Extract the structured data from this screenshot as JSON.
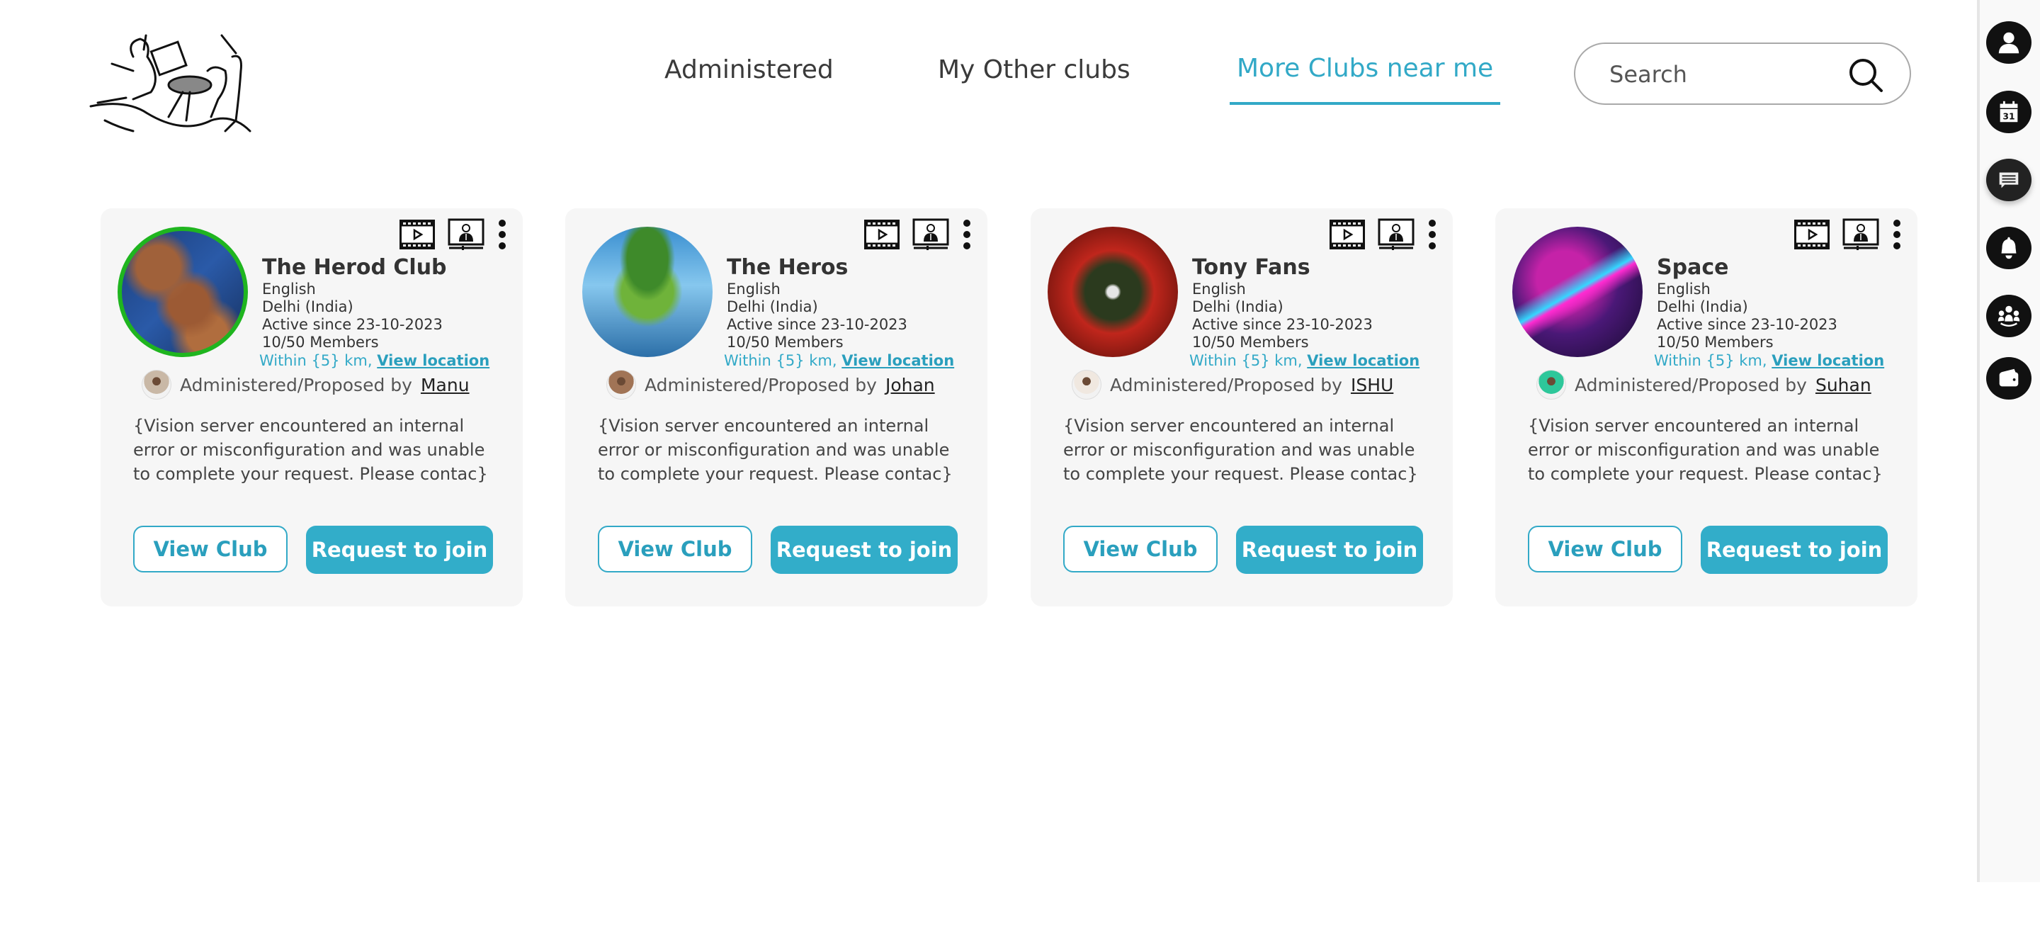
{
  "nav": {
    "tabs": [
      {
        "label": "Administered",
        "active": false
      },
      {
        "label": "My Other clubs",
        "active": false
      },
      {
        "label": "More Clubs near me",
        "active": true
      }
    ]
  },
  "search": {
    "placeholder": "Search",
    "value": ""
  },
  "colors": {
    "accent": "#32a9c7",
    "button_fill": "#32adc9",
    "active_ring": "#1fb51f",
    "rail_bg": "#f9f9f9",
    "card_bg": "#f6f6f6"
  },
  "rail": {
    "icons": [
      "profile-icon",
      "calendar-icon",
      "chat-icon",
      "bell-icon",
      "group-icon",
      "wallet-icon"
    ],
    "calendar_day": "31"
  },
  "clubs": [
    {
      "name": "The Herod Club",
      "language": "English",
      "location": "Delhi (India)",
      "active_since": "Active since 23-10-2023",
      "members": "10/50 Members",
      "distance": "Within {5} km,",
      "view_location": "View location",
      "admin_prefix": "Administered/Proposed by",
      "admin_name": "Manu",
      "description": "{Vision server encountered an internal error or misconfiguration and was unable to complete your request. Please contac}",
      "view_label": "View Club",
      "join_label": "Request to join",
      "image_theme": "nebula-pillars",
      "highlighted": true
    },
    {
      "name": "The Heros",
      "language": "English",
      "location": "Delhi (India)",
      "active_since": "Active since 23-10-2023",
      "members": "10/50 Members",
      "distance": "Within {5} km,",
      "view_location": "View location",
      "admin_prefix": "Administered/Proposed by",
      "admin_name": "Johan",
      "description": "{Vision server encountered an internal error or misconfiguration and was unable to complete your request. Please contac}",
      "view_label": "View Club",
      "join_label": "Request to join",
      "image_theme": "floating-island",
      "highlighted": false
    },
    {
      "name": "Tony Fans",
      "language": "English",
      "location": "Delhi (India)",
      "active_since": "Active since 23-10-2023",
      "members": "10/50 Members",
      "distance": "Within {5} km,",
      "view_location": "View location",
      "admin_prefix": "Administered/Proposed by",
      "admin_name": "ISHU",
      "description": "{Vision server encountered an internal error or misconfiguration and was unable to complete your request. Please contac}",
      "view_label": "View Club",
      "join_label": "Request to join",
      "image_theme": "red-flowers",
      "highlighted": false
    },
    {
      "name": "Space",
      "language": "English",
      "location": "Delhi (India)",
      "active_since": "Active since 23-10-2023",
      "members": "10/50 Members",
      "distance": "Within {5} km,",
      "view_location": "View location",
      "admin_prefix": "Administered/Proposed by",
      "admin_name": "Suhan",
      "description": "{Vision server encountered an internal error or misconfiguration and was unable to complete your request. Please contac}",
      "view_label": "View Club",
      "join_label": "Request to join",
      "image_theme": "purple-galaxy",
      "highlighted": false
    }
  ]
}
